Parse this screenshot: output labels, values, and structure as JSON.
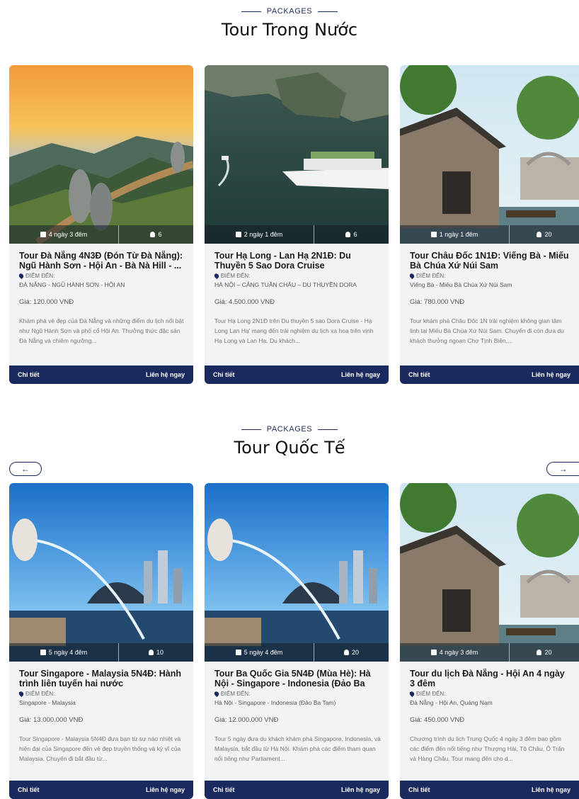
{
  "domestic": {
    "kicker": "PACKAGES",
    "title": "Tour Trong Nước",
    "cards": [
      {
        "duration": "4 ngày 3 đêm",
        "people": "6",
        "title": "Tour Đà Nẵng 4N3Đ (Đón Từ Đà Nẵng): Ngũ Hành Sơn - Hội An - Bà Nà Hill - ...",
        "dest_label": "ĐIỂM ĐẾN:",
        "dest": "ĐÀ NẴNG - NGŨ HÀNH SƠN - HỘI AN",
        "price": "Giá: 120.000 VNĐ",
        "desc": "Khám phá vẻ đẹp của Đà Nẵng và những điểm du lịch nổi bật như Ngũ Hành Sơn và phố cổ Hội An. Thưởng thức đặc sản Đà Nẵng và chiêm ngưỡng...",
        "detail": "Chi tiết",
        "contact": "Liên hệ ngay"
      },
      {
        "duration": "2 ngày 1 đêm",
        "people": "6",
        "title": "Tour Hạ Long - Lan Hạ 2N1Đ: Du Thuyền 5 Sao Dora Cruise",
        "dest_label": "ĐIỂM ĐẾN:",
        "dest": "HÀ NỘI – CẢNG TUẦN CHÂU – DU THUYỀN DORA",
        "price": "Giá: 4.500.000 VNĐ",
        "desc": "Tour Hạ Long 2N1Đ trên Du thuyền 5 sao Dora Cruise - Hạ Long Lan Hạ' mang đến trải nghiệm du lịch xa hoa trên vịnh Hạ Long và Lan Hạ. Du khách...",
        "detail": "Chi tiết",
        "contact": "Liên hệ ngay"
      },
      {
        "duration": "1 ngày 1 đêm",
        "people": "20",
        "title": "Tour Châu Đốc 1N1Đ: Viếng Bà - Miếu Bà Chúa Xứ Núi Sam",
        "dest_label": "ĐIỂM ĐẾN:",
        "dest": "Viếng Bà - Miếu Bà Chúa Xứ Núi Sam",
        "price": "Giá: 780.000 VNĐ",
        "desc": "Tour khám phá Châu Đốc 1N trải nghiệm không gian tâm linh tại Miếu Bà Chúa Xứ Núi Sam. Chuyến đi còn đưa du khách thưởng ngoạn Chợ Tịnh Biên,...",
        "detail": "Chi tiết",
        "contact": "Liên hệ ngay"
      }
    ]
  },
  "international": {
    "kicker": "PACKAGES",
    "title": "Tour Quốc Tế",
    "prev_icon": "arrow-left",
    "next_icon": "arrow-right",
    "prev_glyph": "←",
    "next_glyph": "→",
    "cards": [
      {
        "duration": "5 ngày 4 đêm",
        "people": "10",
        "title": "Tour Singapore - Malaysia 5N4Đ: Hành trình liên tuyến hai nước",
        "dest_label": "ĐIỂM ĐẾN:",
        "dest": "Singapore - Malaysia",
        "price": "Giá: 13.000.000 VNĐ",
        "desc": "Tour Singapore - Malaysia 5N4Đ đưa bạn từ sự náo nhiệt và hiện đại của Singapore đến vẻ đẹp truyền thống và kỳ vĩ của Malaysia. Chuyến đi bắt đầu từ...",
        "detail": "Chi tiết",
        "contact": "Liên hệ ngay"
      },
      {
        "duration": "5 ngày 4 đêm",
        "people": "20",
        "title": "Tour Ba Quốc Gia 5N4Đ (Mùa Hè): Hà Nội - Singapore - Indonesia (Đảo Ba Ta...",
        "dest_label": "ĐIỂM ĐẾN:",
        "dest": "Hà Nội - Singapore - Indonesia (Đảo Ba Tam)",
        "price": "Giá: 12.000.000 VNĐ",
        "desc": "Tour 5 ngày đưa du khách khám phá Singapore, Indonesia, và Malaysia, bắt đầu từ Hà Nội. Khám phá các điểm tham quan nổi tiếng như Parliament...",
        "detail": "Chi tiết",
        "contact": "Liên hệ ngay"
      },
      {
        "duration": "4 ngày 3 đêm",
        "people": "20",
        "title": "Tour du lịch Đà Nẵng - Hội An 4 ngày 3 đêm",
        "dest_label": "ĐIỂM ĐẾN:",
        "dest": "Đà Nẵng - Hội An, Quảng Nam",
        "price": "Giá: 450.000 VNĐ",
        "desc": "Chương trình du lịch Trung Quốc 4 ngày 3 đêm bao gồm các điểm đến nổi tiếng như Thượng Hải, Tô Châu, Ô Trấn và Hàng Châu. Tour mang đến cho d...",
        "detail": "Chi tiết",
        "contact": "Liên hệ ngay"
      }
    ]
  }
}
